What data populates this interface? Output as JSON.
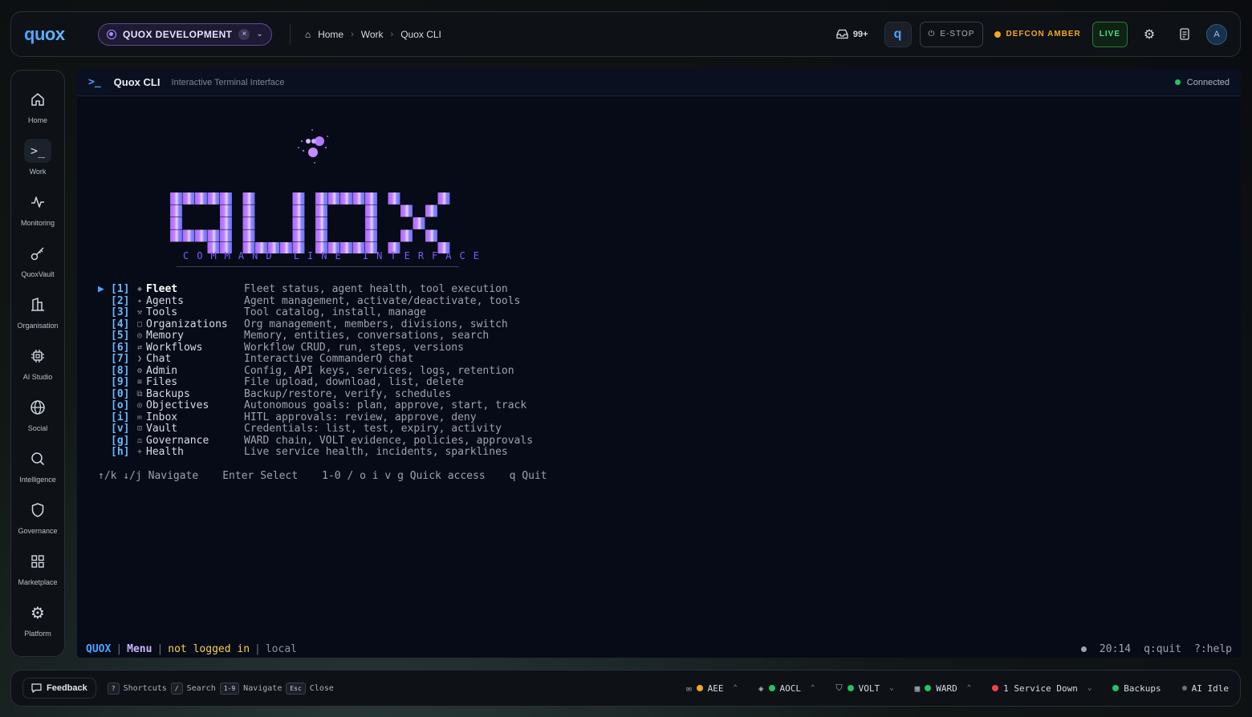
{
  "topbar": {
    "logo": "quox",
    "org": "QUOX DEVELOPMENT",
    "breadcrumbs": [
      "Home",
      "Work",
      "Quox CLI"
    ],
    "inbox_count": "99+",
    "estop_label": "E-STOP",
    "defcon_label": "DEFCON AMBER",
    "live_label": "LIVE",
    "avatar_initial": "A"
  },
  "sidebar": {
    "items": [
      {
        "label": "Home",
        "icon": "home-icon"
      },
      {
        "label": "Work",
        "icon": "terminal-icon"
      },
      {
        "label": "Monitoring",
        "icon": "activity-icon"
      },
      {
        "label": "QuoxVault",
        "icon": "key-icon"
      },
      {
        "label": "Organisation",
        "icon": "building-icon"
      },
      {
        "label": "AI Studio",
        "icon": "chip-icon"
      },
      {
        "label": "Social",
        "icon": "globe-icon"
      },
      {
        "label": "Intelligence",
        "icon": "search-icon"
      },
      {
        "label": "Governance",
        "icon": "shield-icon"
      },
      {
        "label": "Marketplace",
        "icon": "grid-icon"
      },
      {
        "label": "Platform",
        "icon": "gear-icon"
      }
    ]
  },
  "terminal": {
    "title": "Quox CLI",
    "subtitle": "Interactive Terminal Interface",
    "connection": "Connected",
    "tagline": "COMMAND LINE INTERFACE",
    "menu": [
      {
        "key": "[1]",
        "icon": "◈",
        "name": "Fleet",
        "desc": "Fleet status, agent health, tool execution"
      },
      {
        "key": "[2]",
        "icon": "✦",
        "name": "Agents",
        "desc": "Agent management, activate/deactivate, tools"
      },
      {
        "key": "[3]",
        "icon": "⚒",
        "name": "Tools",
        "desc": "Tool catalog, install, manage"
      },
      {
        "key": "[4]",
        "icon": "▢",
        "name": "Organizations",
        "desc": "Org management, members, divisions, switch"
      },
      {
        "key": "[5]",
        "icon": "◎",
        "name": "Memory",
        "desc": "Memory, entities, conversations, search"
      },
      {
        "key": "[6]",
        "icon": "⇄",
        "name": "Workflows",
        "desc": "Workflow CRUD, run, steps, versions"
      },
      {
        "key": "[7]",
        "icon": "❯",
        "name": "Chat",
        "desc": "Interactive CommanderQ chat"
      },
      {
        "key": "[8]",
        "icon": "⚙",
        "name": "Admin",
        "desc": "Config, API keys, services, logs, retention"
      },
      {
        "key": "[9]",
        "icon": "≡",
        "name": "Files",
        "desc": "File upload, download, list, delete"
      },
      {
        "key": "[0]",
        "icon": "⧉",
        "name": "Backups",
        "desc": "Backup/restore, verify, schedules"
      },
      {
        "key": "[o]",
        "icon": "◎",
        "name": "Objectives",
        "desc": "Autonomous goals: plan, approve, start, track"
      },
      {
        "key": "[i]",
        "icon": "✉",
        "name": "Inbox",
        "desc": "HITL approvals: review, approve, deny"
      },
      {
        "key": "[v]",
        "icon": "⊡",
        "name": "Vault",
        "desc": "Credentials: list, test, expiry, activity"
      },
      {
        "key": "[g]",
        "icon": "⚖",
        "name": "Governance",
        "desc": "WARD chain, VOLT evidence, policies, approvals"
      },
      {
        "key": "[h]",
        "icon": "+",
        "name": "Health",
        "desc": "Live service health, incidents, sparklines"
      }
    ],
    "hints": [
      "↑/k ↓/j Navigate",
      "Enter Select",
      "1-0 / o i v g Quick access",
      "q Quit"
    ],
    "status": {
      "brand": "QUOX",
      "menu": "Menu",
      "login": "not logged in",
      "env": "local",
      "time": "20:14",
      "quit": "q:quit",
      "help": "?:help"
    }
  },
  "bottombar": {
    "feedback": "Feedback",
    "shortcuts": [
      {
        "key": "?",
        "label": "Shortcuts"
      },
      {
        "key": "/",
        "label": "Search"
      },
      {
        "key": "1-9",
        "label": "Navigate"
      },
      {
        "key": "Esc",
        "label": "Close"
      }
    ],
    "services": [
      {
        "label": "AEE",
        "color": "#f5a623"
      },
      {
        "label": "AOCL",
        "color": "#22c55e"
      },
      {
        "label": "VOLT",
        "color": "#22c55e"
      },
      {
        "label": "WARD",
        "color": "#22c55e"
      },
      {
        "label": "1 Service Down",
        "color": "#ef4444"
      },
      {
        "label": "Backups",
        "color": "#22c55e"
      },
      {
        "label": "AI Idle",
        "color": "#6b7280"
      }
    ]
  },
  "colors": {
    "accent": "#4aa3ff",
    "logo_purple": "#a66bff",
    "ok": "#22c55e",
    "warn": "#f5a623"
  }
}
